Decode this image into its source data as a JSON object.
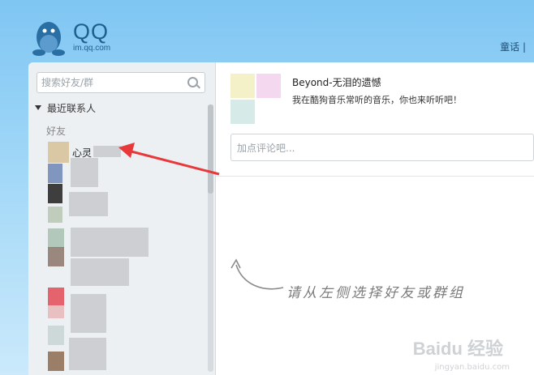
{
  "header": {
    "logo_text": "QQ",
    "logo_sub": "im.qq.com",
    "top_link": "童话 |"
  },
  "sidebar": {
    "search_placeholder": "搜索好友/群",
    "recent_label": "最近联系人",
    "group_label": "好友",
    "friends": [
      {
        "name": "心灵"
      }
    ]
  },
  "feed": {
    "song_title": "Beyond-无泪的遗憾",
    "description": "我在酷狗音乐常听的音乐，你也来听听吧！",
    "comment_placeholder": "加点评论吧..."
  },
  "main": {
    "hint": "请从左侧选择好友或群组"
  },
  "watermark": {
    "brand": "Baidu 经验",
    "url": "jingyan.baidu.com"
  },
  "colors": {
    "accent": "#7fc6f3",
    "arrow": "#e8383a"
  }
}
